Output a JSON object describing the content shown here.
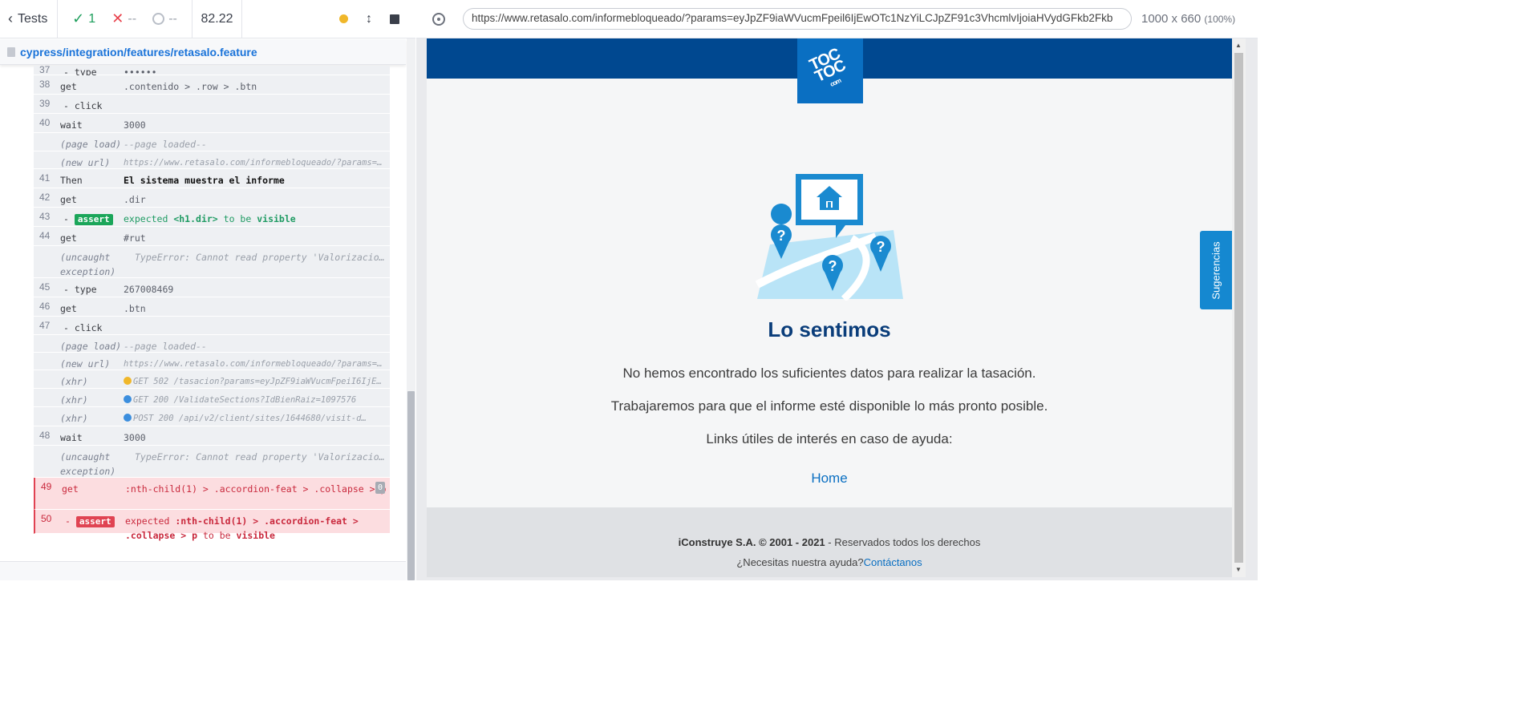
{
  "reporter": {
    "tests_label": "Tests",
    "passed": "1",
    "failed": "--",
    "pending": "--",
    "duration": "82.22",
    "spec_path": "cypress/integration/features/retasalo.feature"
  },
  "commands": [
    {
      "num": "37",
      "name": "- type",
      "msg": "••••••"
    },
    {
      "num": "38",
      "name": "get",
      "msg": ".contenido > .row > .btn"
    },
    {
      "num": "39",
      "name": "- click",
      "msg": ""
    },
    {
      "num": "40",
      "name": "wait",
      "msg": "3000"
    },
    {
      "num": "",
      "name": "(page load)",
      "msg": "--page loaded--"
    },
    {
      "num": "",
      "name": "(new url)",
      "msg": "https://www.retasalo.com/informebloqueado/?params=eyJpZF…"
    },
    {
      "num": "41",
      "name": "Then",
      "msg": "El sistema muestra el informe"
    },
    {
      "num": "42",
      "name": "get",
      "msg": ".dir"
    },
    {
      "num": "43",
      "name": "assert",
      "msg_a": "expected",
      "msg_b": "<h1.dir>",
      "msg_c": "to be",
      "msg_d": "visible"
    },
    {
      "num": "44",
      "name": "get",
      "msg": "#rut"
    },
    {
      "num": "",
      "name": "(uncaught exception)",
      "msg": "TypeError: Cannot read property 'Valorizacion…"
    },
    {
      "num": "45",
      "name": "- type",
      "msg": "267008469"
    },
    {
      "num": "46",
      "name": "get",
      "msg": ".btn"
    },
    {
      "num": "47",
      "name": "- click",
      "msg": ""
    },
    {
      "num": "",
      "name": "(page load)",
      "msg": "--page loaded--"
    },
    {
      "num": "",
      "name": "(new url)",
      "msg": "https://www.retasalo.com/informebloqueado/?params=eyJpZF…"
    },
    {
      "num": "",
      "name": "(xhr)",
      "msg": "GET 502 /tasacion?params=eyJpZF9iaWVucmFpeiI6IjEwOTc1…"
    },
    {
      "num": "",
      "name": "(xhr)",
      "msg": "GET 200 /ValidateSections?IdBienRaiz=1097576"
    },
    {
      "num": "",
      "name": "(xhr)",
      "msg": "POST 200 /api/v2/client/sites/1644680/visit-d…"
    },
    {
      "num": "48",
      "name": "wait",
      "msg": "3000"
    },
    {
      "num": "",
      "name": "(uncaught exception)",
      "msg": "TypeError: Cannot read property 'Valorizacion…"
    },
    {
      "num": "49",
      "name": "get",
      "msg": ":nth-child(1) > .accordion-feat > .collapse > p",
      "count": "0"
    },
    {
      "num": "50",
      "name": "assert",
      "msg_a": "expected",
      "msg_b": ":nth-child(1) > .accordion-feat > .collapse > p",
      "msg_c": "to be",
      "msg_d": "visible"
    }
  ],
  "aut": {
    "url": "https://www.retasalo.com/informebloqueado/?params=eyJpZF9iaWVucmFpeil6IjEwOTc1NzYiLCJpZF91c3VhcmlvIjoiaHVydGFkb2Fkb",
    "viewport": "1000 x 660",
    "zoom": "(100%)"
  },
  "site": {
    "logo_text": "TOC TOC",
    "logo_com": "com",
    "title": "Lo sentimos",
    "p1": "No hemos encontrado los suficientes datos para realizar la tasación.",
    "p2": "Trabajaremos para que el informe esté disponible lo más pronto posible.",
    "p3": "Links útiles de interés en caso de ayuda:",
    "home_link": "Home",
    "copyright_bold": "iConstruye S.A. © 2001 - 2021",
    "copyright_rest": " - Reservados todos los derechos",
    "help_text": "¿Necesitas nuestra ayuda?",
    "contact_link": "Contáctanos",
    "suggestions_tab": "Sugerencias"
  },
  "colors": {
    "pass": "#1c9e5b",
    "fail": "#e8414c",
    "brand_navy": "#004890",
    "brand_blue": "#0a6fc2"
  }
}
